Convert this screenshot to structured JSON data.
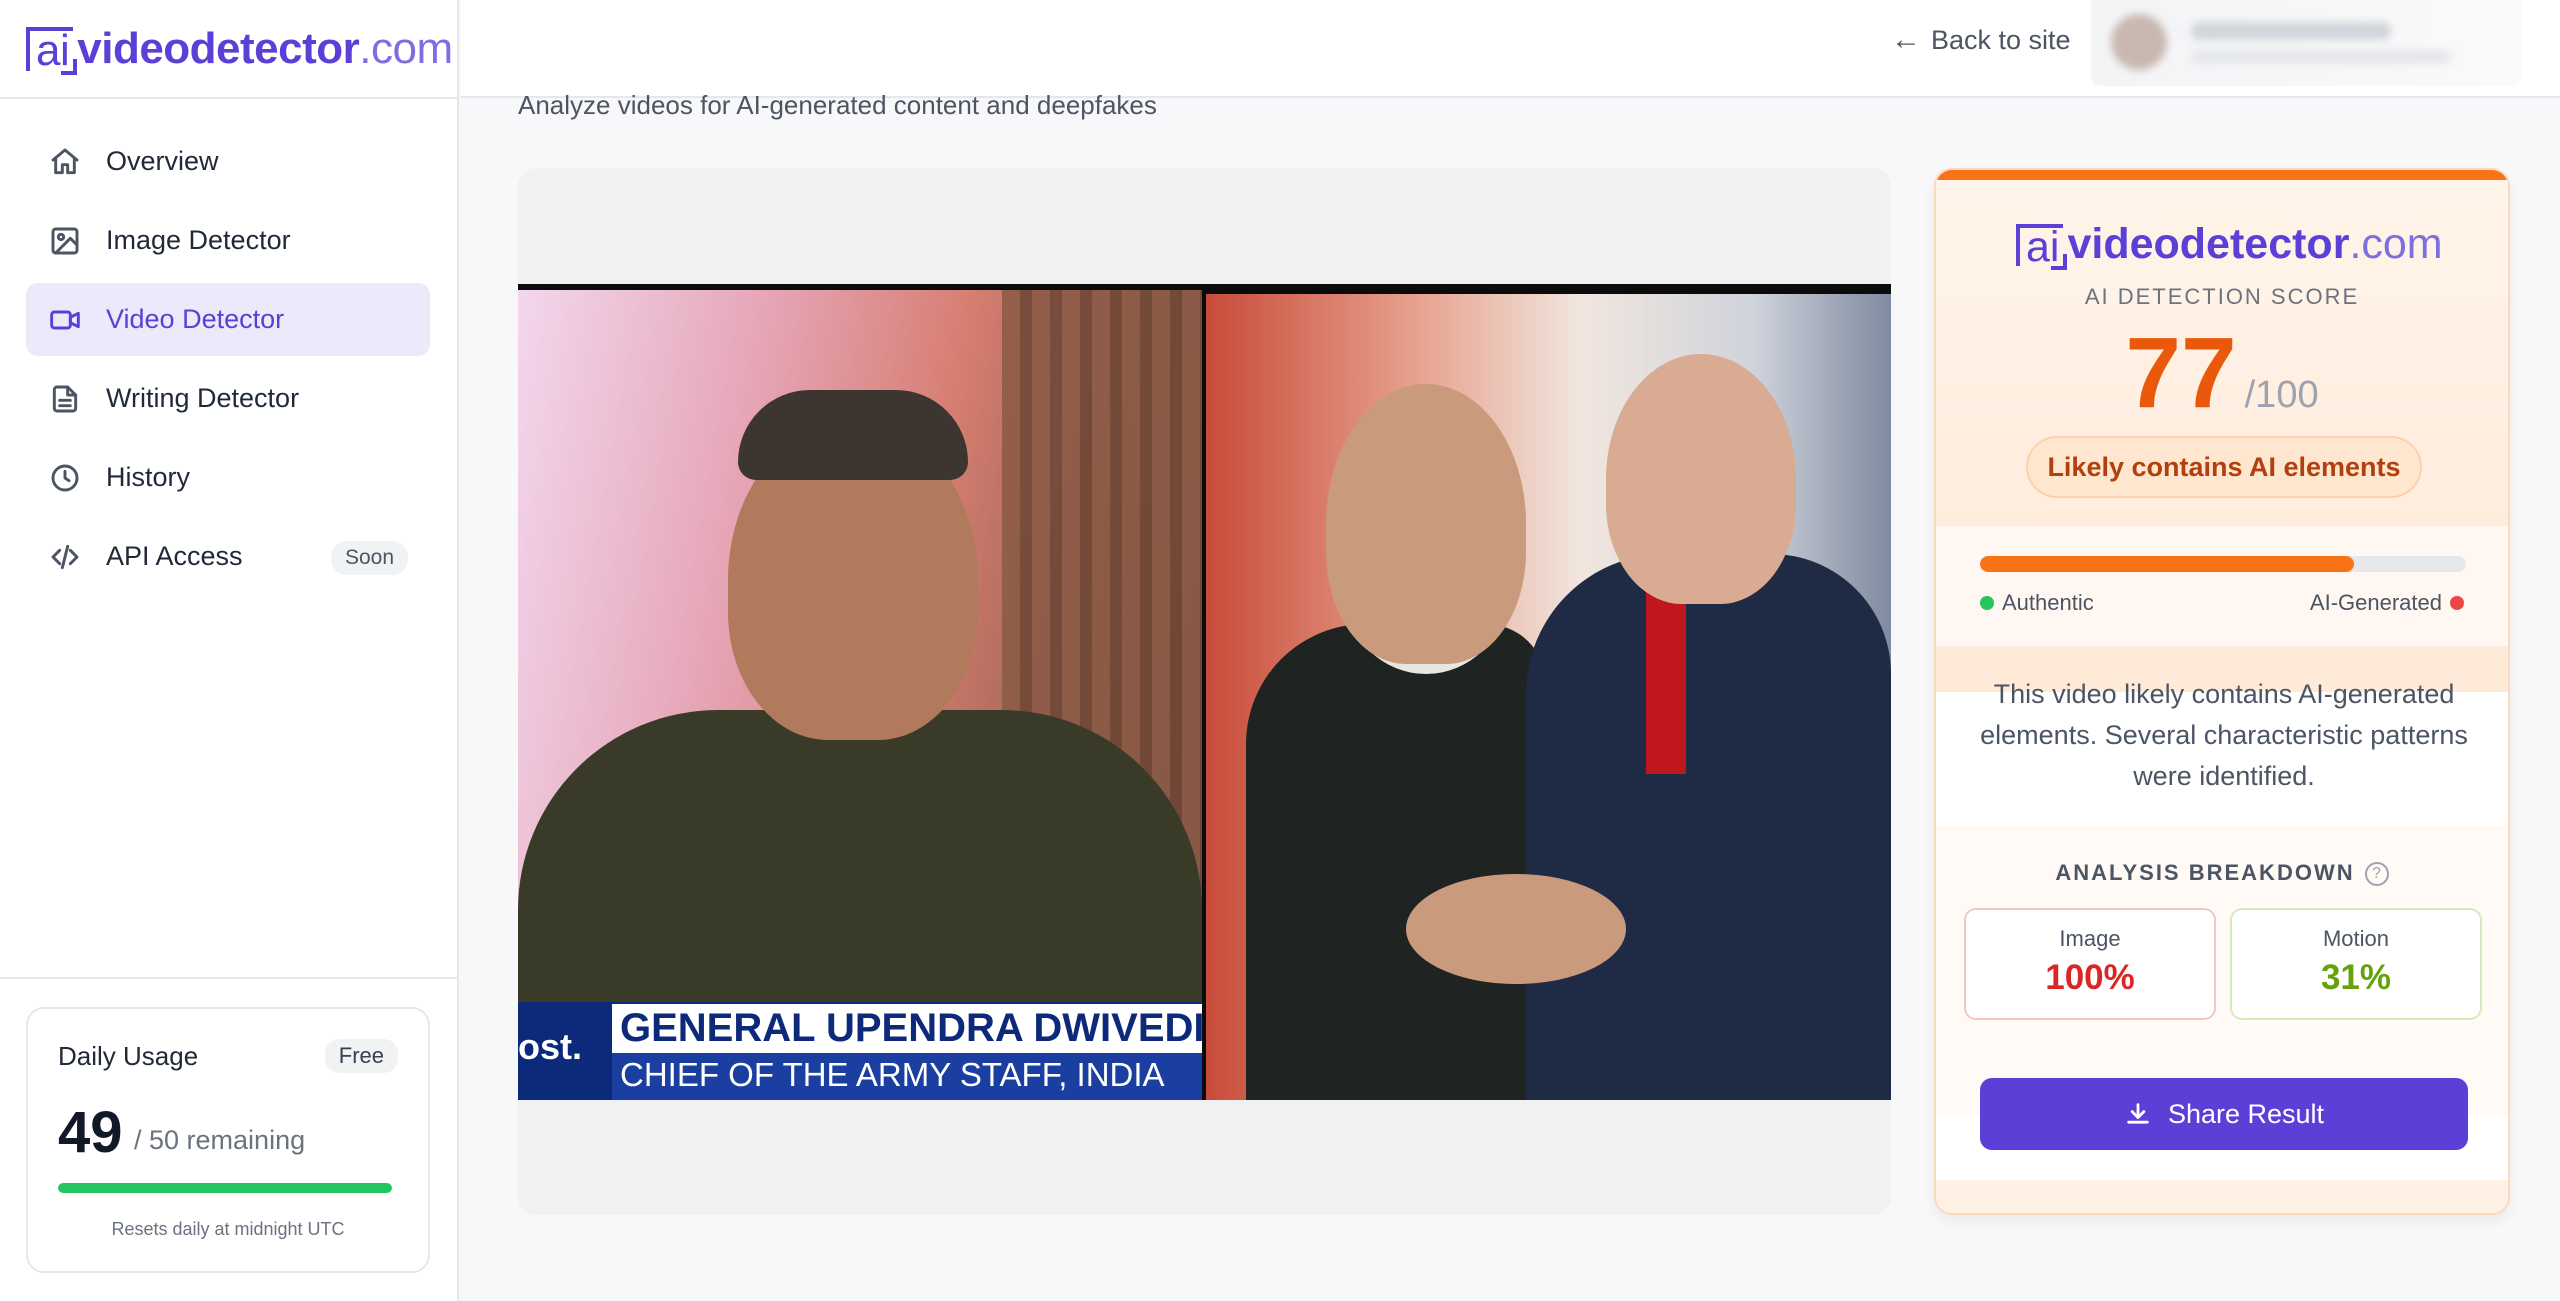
{
  "brand": {
    "ai": "ai",
    "name": "videodetector",
    "tld": ".com"
  },
  "sidebar": {
    "items": [
      {
        "label": "Overview",
        "icon": "home-icon"
      },
      {
        "label": "Image Detector",
        "icon": "image-icon"
      },
      {
        "label": "Video Detector",
        "icon": "video-icon",
        "active": true
      },
      {
        "label": "Writing Detector",
        "icon": "document-icon"
      },
      {
        "label": "History",
        "icon": "clock-icon"
      },
      {
        "label": "API Access",
        "icon": "code-icon",
        "badge": "Soon"
      }
    ]
  },
  "usage": {
    "title": "Daily Usage",
    "plan": "Free",
    "count": "49",
    "remaining_text": "/ 50 remaining",
    "used_fraction": 1.0,
    "reset_text": "Resets daily at midnight UTC"
  },
  "header": {
    "back_label": "Back to site",
    "subtitle": "Analyze videos for AI-generated content and deepfakes"
  },
  "video": {
    "caption_logo": "ost.",
    "caption_line1": "GENERAL UPENDRA DWIVEDI,",
    "caption_line2": "CHIEF OF THE ARMY STAFF, INDIA"
  },
  "result": {
    "score_label": "AI DETECTION SCORE",
    "score": "77",
    "score_max": "/100",
    "score_fraction": 0.77,
    "verdict": "Likely contains AI elements",
    "legend_left": "Authentic",
    "legend_right": "AI-Generated",
    "summary": "This video likely contains AI-generated elements. Several characteristic patterns were identified.",
    "breakdown_title": "ANALYSIS BREAKDOWN",
    "breakdown": [
      {
        "label": "Image",
        "value": "100%"
      },
      {
        "label": "Motion",
        "value": "31%"
      }
    ],
    "share_label": "Share Result"
  },
  "colors": {
    "accent": "#5b3fd6",
    "score": "#ea580c",
    "meter": "#f97316",
    "usage_bar": "#22c55e",
    "image_value": "#dc2626",
    "motion_value": "#65a30d"
  }
}
